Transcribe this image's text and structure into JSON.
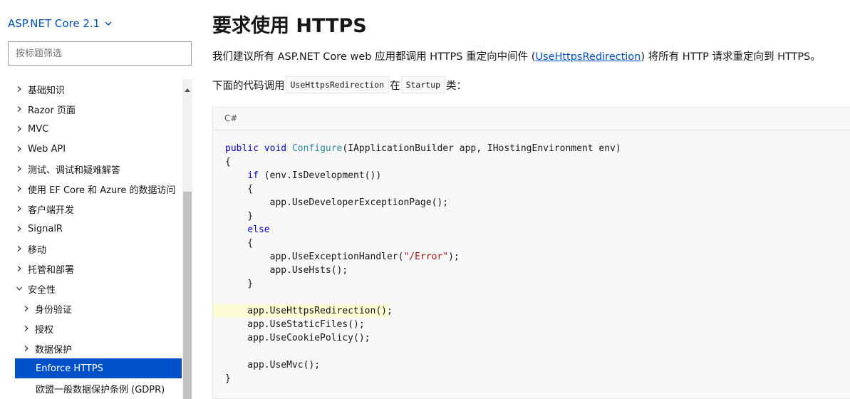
{
  "sidebar": {
    "version_label": "ASP.NET Core 2.1",
    "filter_placeholder": "按标题筛选",
    "items": [
      {
        "label": "基础知识"
      },
      {
        "label": "Razor 页面"
      },
      {
        "label": "MVC"
      },
      {
        "label": "Web API"
      },
      {
        "label": "测试、调试和疑难解答"
      },
      {
        "label": "使用 EF Core 和 Azure 的数据访问"
      },
      {
        "label": "客户端开发"
      },
      {
        "label": "SignalR"
      },
      {
        "label": "移动"
      },
      {
        "label": "托管和部署"
      },
      {
        "label": "安全性"
      },
      {
        "label": "身份验证"
      },
      {
        "label": "授权"
      },
      {
        "label": "数据保护"
      },
      {
        "label": "Enforce HTTPS"
      },
      {
        "label": "欧盟一般数据保护条例 (GDPR)"
      }
    ]
  },
  "main": {
    "title": "要求使用 HTTPS",
    "p1_before": "我们建议所有 ASP.NET Core web 应用都调用 HTTPS 重定向中间件 (",
    "p1_link": "UseHttpsRedirection",
    "p1_after": ") 将所有 HTTP 请求重定向到 HTTPS。",
    "p2_before": "下面的代码调用",
    "p2_code1": "UseHttpsRedirection",
    "p2_middle": "在",
    "p2_code2": "Startup",
    "p2_after": "类："
  },
  "code": {
    "language": "C#",
    "lines": [
      "public void Configure(IApplicationBuilder app, IHostingEnvironment env)",
      "{",
      "    if (env.IsDevelopment())",
      "    {",
      "        app.UseDeveloperExceptionPage();",
      "    }",
      "    else",
      "    {",
      "        app.UseExceptionHandler(\"/Error\");",
      "        app.UseHsts();",
      "    }",
      "",
      "    app.UseHttpsRedirection();",
      "    app.UseStaticFiles();",
      "    app.UseCookiePolicy();",
      "",
      "    app.UseMvc();",
      "}"
    ]
  }
}
